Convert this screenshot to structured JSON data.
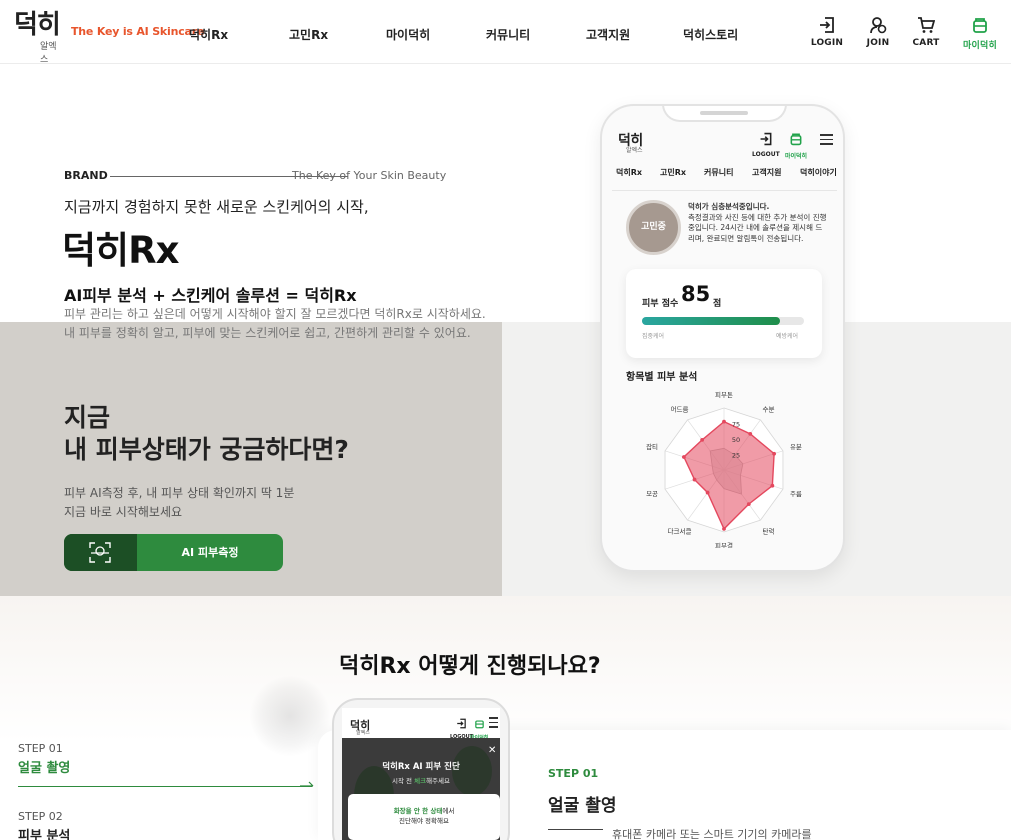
{
  "header": {
    "logo": "덕히",
    "logo_sub": "알엑스",
    "tagline": "The Key is AI Skincare",
    "nav": [
      "덕히Rx",
      "고민Rx",
      "마이덕히",
      "커뮤니티",
      "고객지원",
      "덕히스토리"
    ],
    "utils": [
      {
        "label": "LOGIN",
        "icon": "login-icon"
      },
      {
        "label": "JOIN",
        "icon": "join-icon"
      },
      {
        "label": "CART",
        "icon": "cart-icon"
      },
      {
        "label": "마이덕히",
        "icon": "my-duckhee-icon"
      }
    ]
  },
  "hero": {
    "brand_label": "BRAND",
    "brand_key": "The Key of Your Skin Beauty",
    "intro": "지금까지 경험하지 못한 새로운 스킨케어의 시작,",
    "title": "덕히Rx",
    "formula": "AI피부 분석 + 스킨케어 솔루션 = 덕히Rx",
    "desc1": "피부 관리는 하고 싶은데 어떻게 시작해야 할지 잘 모르겠다면 덕히Rx로 시작하세요.",
    "desc2": "내 피부를 정확히 알고, 피부에 맞는 스킨케어로 쉽고, 간편하게 관리할 수 있어요.",
    "cta_title1": "지금",
    "cta_title2": "내 피부상태가 궁금하다면?",
    "cta_desc1": "피부 AI측정 후, 내 피부 상태 확인까지 딱 1분",
    "cta_desc2": "지금 바로 시작해보세요",
    "cta_button": "AI 피부측정"
  },
  "phone": {
    "logo": "덕히",
    "logo_sub": "알엑스",
    "utils": [
      "LOGOUT",
      "마이덕히"
    ],
    "nav": [
      "덕히Rx",
      "고민Rx",
      "커뮤니티",
      "고객지원",
      "덕히이야기"
    ],
    "avatar_label": "고민중",
    "status_title": "덕히가 심층분석중입니다.",
    "status_body": "측정결과와 사진 등에 대한 추가 분석이 진행중입니다. 24시간 내에 솔루션을 제시해 드리며, 완료되면 알림톡이 전송됩니다.",
    "score_label": "피부 점수",
    "score_value": "85",
    "score_unit": "점",
    "score_fraction": 0.85,
    "bar_min": "집중케어",
    "bar_max": "예방케어",
    "radar_title": "항목별 피부 분석"
  },
  "chart_data": {
    "type": "radar",
    "categories": [
      "피부톤",
      "수분",
      "유분",
      "주름",
      "탄력",
      "피부결",
      "다크서클",
      "모공",
      "잡티",
      "어드름"
    ],
    "values": [
      78,
      72,
      85,
      82,
      68,
      95,
      45,
      50,
      68,
      60
    ],
    "reference": [
      35,
      30,
      32,
      28,
      48,
      30,
      20,
      18,
      20,
      38
    ],
    "ticks": [
      "25",
      "50",
      "75"
    ],
    "range": [
      0,
      100
    ],
    "colors": {
      "series": "#e4485e",
      "reference": "#cfcfcf"
    }
  },
  "process": {
    "title": "덕히Rx 어떻게 진행되나요?",
    "steps": [
      {
        "label": "STEP 01",
        "name": "얼굴 촬영"
      },
      {
        "label": "STEP 02",
        "name": "피부 분석"
      }
    ],
    "detail_step": "STEP 01",
    "detail_name": "얼굴 촬영",
    "detail_desc": "휴대폰 카메라 또는 스마트 기기의 카메라를",
    "phone": {
      "logo": "덕히",
      "logo_sub": "알엑스",
      "utils": [
        "LOGOUT",
        "마이덕히"
      ],
      "modal_title": "덕히Rx AI 피부 진단",
      "modal_sub_before": "시작 전 ",
      "modal_sub_highlight": "체크",
      "modal_sub_after": "해주세요",
      "card_highlight": "화장을 안 한 상태",
      "card_text1_after": "에서",
      "card_text2": "진단해야 정확해요"
    }
  },
  "colors": {
    "brand_orange": "#e8552c",
    "brand_green": "#2e8b3e",
    "dark_green": "#1c4f25",
    "accent_green": "#21a24a",
    "radar_red": "#e4485e"
  }
}
